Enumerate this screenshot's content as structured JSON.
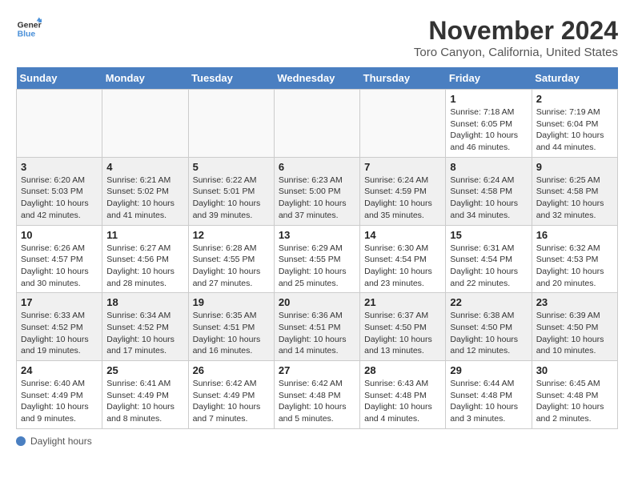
{
  "logo": {
    "line1": "General",
    "line2": "Blue"
  },
  "title": "November 2024",
  "location": "Toro Canyon, California, United States",
  "days_of_week": [
    "Sunday",
    "Monday",
    "Tuesday",
    "Wednesday",
    "Thursday",
    "Friday",
    "Saturday"
  ],
  "footer": {
    "label": "Daylight hours"
  },
  "weeks": [
    [
      {
        "day": "",
        "info": "",
        "empty": true
      },
      {
        "day": "",
        "info": "",
        "empty": true
      },
      {
        "day": "",
        "info": "",
        "empty": true
      },
      {
        "day": "",
        "info": "",
        "empty": true
      },
      {
        "day": "",
        "info": "",
        "empty": true
      },
      {
        "day": "1",
        "info": "Sunrise: 7:18 AM\nSunset: 6:05 PM\nDaylight: 10 hours and 46 minutes."
      },
      {
        "day": "2",
        "info": "Sunrise: 7:19 AM\nSunset: 6:04 PM\nDaylight: 10 hours and 44 minutes."
      }
    ],
    [
      {
        "day": "3",
        "info": "Sunrise: 6:20 AM\nSunset: 5:03 PM\nDaylight: 10 hours and 42 minutes."
      },
      {
        "day": "4",
        "info": "Sunrise: 6:21 AM\nSunset: 5:02 PM\nDaylight: 10 hours and 41 minutes."
      },
      {
        "day": "5",
        "info": "Sunrise: 6:22 AM\nSunset: 5:01 PM\nDaylight: 10 hours and 39 minutes."
      },
      {
        "day": "6",
        "info": "Sunrise: 6:23 AM\nSunset: 5:00 PM\nDaylight: 10 hours and 37 minutes."
      },
      {
        "day": "7",
        "info": "Sunrise: 6:24 AM\nSunset: 4:59 PM\nDaylight: 10 hours and 35 minutes."
      },
      {
        "day": "8",
        "info": "Sunrise: 6:24 AM\nSunset: 4:58 PM\nDaylight: 10 hours and 34 minutes."
      },
      {
        "day": "9",
        "info": "Sunrise: 6:25 AM\nSunset: 4:58 PM\nDaylight: 10 hours and 32 minutes."
      }
    ],
    [
      {
        "day": "10",
        "info": "Sunrise: 6:26 AM\nSunset: 4:57 PM\nDaylight: 10 hours and 30 minutes."
      },
      {
        "day": "11",
        "info": "Sunrise: 6:27 AM\nSunset: 4:56 PM\nDaylight: 10 hours and 28 minutes."
      },
      {
        "day": "12",
        "info": "Sunrise: 6:28 AM\nSunset: 4:55 PM\nDaylight: 10 hours and 27 minutes."
      },
      {
        "day": "13",
        "info": "Sunrise: 6:29 AM\nSunset: 4:55 PM\nDaylight: 10 hours and 25 minutes."
      },
      {
        "day": "14",
        "info": "Sunrise: 6:30 AM\nSunset: 4:54 PM\nDaylight: 10 hours and 23 minutes."
      },
      {
        "day": "15",
        "info": "Sunrise: 6:31 AM\nSunset: 4:54 PM\nDaylight: 10 hours and 22 minutes."
      },
      {
        "day": "16",
        "info": "Sunrise: 6:32 AM\nSunset: 4:53 PM\nDaylight: 10 hours and 20 minutes."
      }
    ],
    [
      {
        "day": "17",
        "info": "Sunrise: 6:33 AM\nSunset: 4:52 PM\nDaylight: 10 hours and 19 minutes."
      },
      {
        "day": "18",
        "info": "Sunrise: 6:34 AM\nSunset: 4:52 PM\nDaylight: 10 hours and 17 minutes."
      },
      {
        "day": "19",
        "info": "Sunrise: 6:35 AM\nSunset: 4:51 PM\nDaylight: 10 hours and 16 minutes."
      },
      {
        "day": "20",
        "info": "Sunrise: 6:36 AM\nSunset: 4:51 PM\nDaylight: 10 hours and 14 minutes."
      },
      {
        "day": "21",
        "info": "Sunrise: 6:37 AM\nSunset: 4:50 PM\nDaylight: 10 hours and 13 minutes."
      },
      {
        "day": "22",
        "info": "Sunrise: 6:38 AM\nSunset: 4:50 PM\nDaylight: 10 hours and 12 minutes."
      },
      {
        "day": "23",
        "info": "Sunrise: 6:39 AM\nSunset: 4:50 PM\nDaylight: 10 hours and 10 minutes."
      }
    ],
    [
      {
        "day": "24",
        "info": "Sunrise: 6:40 AM\nSunset: 4:49 PM\nDaylight: 10 hours and 9 minutes."
      },
      {
        "day": "25",
        "info": "Sunrise: 6:41 AM\nSunset: 4:49 PM\nDaylight: 10 hours and 8 minutes."
      },
      {
        "day": "26",
        "info": "Sunrise: 6:42 AM\nSunset: 4:49 PM\nDaylight: 10 hours and 7 minutes."
      },
      {
        "day": "27",
        "info": "Sunrise: 6:42 AM\nSunset: 4:48 PM\nDaylight: 10 hours and 5 minutes."
      },
      {
        "day": "28",
        "info": "Sunrise: 6:43 AM\nSunset: 4:48 PM\nDaylight: 10 hours and 4 minutes."
      },
      {
        "day": "29",
        "info": "Sunrise: 6:44 AM\nSunset: 4:48 PM\nDaylight: 10 hours and 3 minutes."
      },
      {
        "day": "30",
        "info": "Sunrise: 6:45 AM\nSunset: 4:48 PM\nDaylight: 10 hours and 2 minutes."
      }
    ]
  ]
}
